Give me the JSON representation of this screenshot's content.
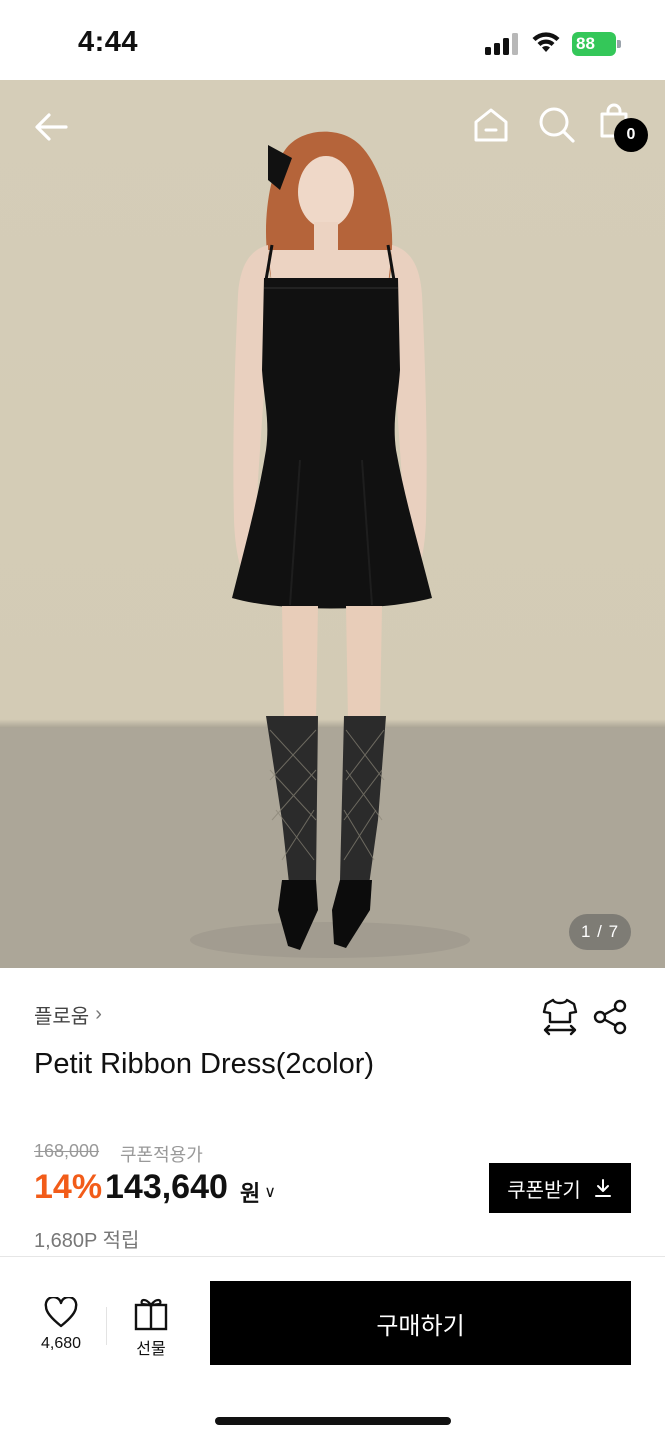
{
  "status_bar": {
    "time": "4:44",
    "battery": "88"
  },
  "hero": {
    "page_indicator": "1 / 7",
    "cart_count": "0",
    "icons": [
      "back-arrow-icon",
      "home-icon",
      "search-icon",
      "shopping-bag-icon"
    ]
  },
  "product": {
    "brand": "플로움",
    "name": "Petit Ribbon Dress(2color)",
    "original_price": "168,000",
    "coupon_label": "쿠폰적용가",
    "discount": "14%",
    "price": "143,640",
    "currency": "원",
    "coupon_button": "쿠폰받기",
    "points": "1,680P 적립"
  },
  "bottom_bar": {
    "like_count": "4,680",
    "gift_label": "선물",
    "buy_label": "구매하기"
  },
  "colors": {
    "discount": "#f25c19",
    "battery": "#34c759",
    "primary_button": "#000000"
  }
}
